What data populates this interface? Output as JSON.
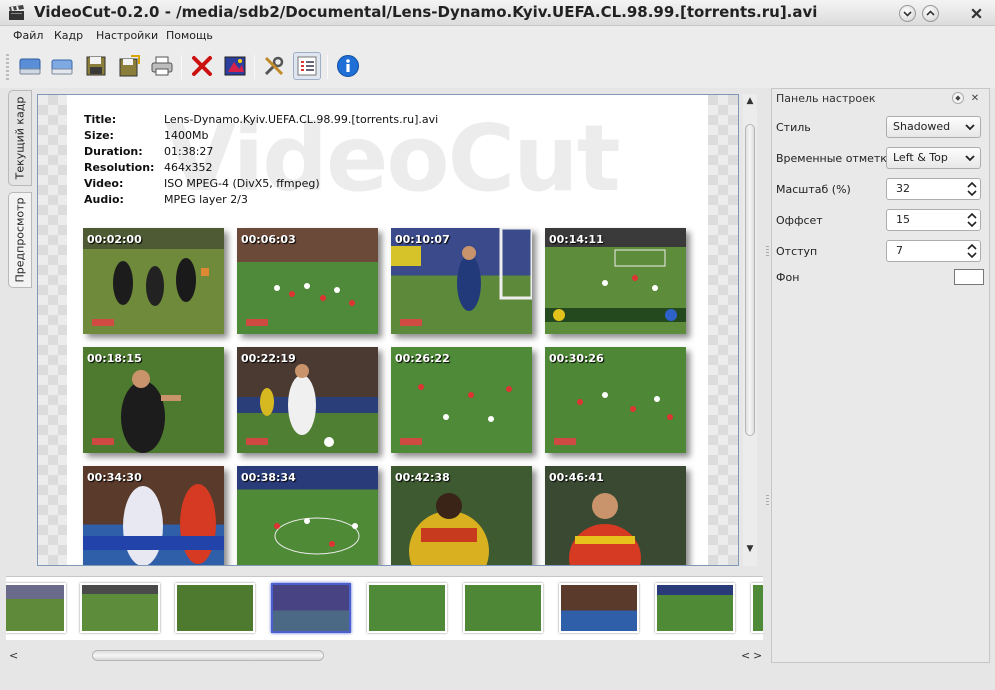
{
  "window": {
    "title": "VideoCut-0.2.0 - /media/sdb2/Documental/Lens-Dynamo.Kyiv.UEFA.CL.98.99.[torrents.ru].avi"
  },
  "menu": {
    "items": [
      "Файл",
      "Кадр",
      "Настройки",
      "Помощь"
    ]
  },
  "toolbar": {
    "buttons": [
      "open-icon",
      "open-folder-icon",
      "save-icon",
      "save-all-icon",
      "print-icon",
      "delete-icon",
      "image-icon",
      "tools-icon",
      "list-icon",
      "info-icon"
    ]
  },
  "tabs": {
    "current_frame": "Текущий кадр",
    "preview": "Предпросмотр"
  },
  "preview": {
    "watermark": "VideoCut",
    "info": [
      {
        "key": "Title:",
        "value": "Lens-Dynamo.Kyiv.UEFA.CL.98.99.[torrents.ru].avi"
      },
      {
        "key": "Size:",
        "value": "1400Mb"
      },
      {
        "key": "Duration:",
        "value": "01:38:27"
      },
      {
        "key": "Resolution:",
        "value": "464x352"
      },
      {
        "key": "Video:",
        "value": "ISO MPEG-4 (DivX5, ffmpeg)"
      },
      {
        "key": "Audio:",
        "value": "MPEG layer 2/3"
      }
    ],
    "thumbnails": [
      "00:02:00",
      "00:06:03",
      "00:10:07",
      "00:14:11",
      "00:18:15",
      "00:22:19",
      "00:26:22",
      "00:30:26",
      "00:34:30",
      "00:38:34",
      "00:42:38",
      "00:46:41"
    ]
  },
  "filmstrip": {
    "count": 9,
    "selected_index": 3
  },
  "settings": {
    "panel_title": "Панель настроек",
    "style_label": "Стиль",
    "style_value": "Shadowed",
    "timestamps_label": "Временные отметки",
    "timestamps_value": "Left & Top",
    "scale_label": "Масштаб (%)",
    "scale_value": "32",
    "offset_label": "Оффсет",
    "offset_value": "15",
    "indent_label": "Отступ",
    "indent_value": "7",
    "background_label": "Фон",
    "background_color": "#ffffff"
  },
  "colors": {
    "accent": "#4c5fcf",
    "frame_border": "#7f97b8"
  }
}
